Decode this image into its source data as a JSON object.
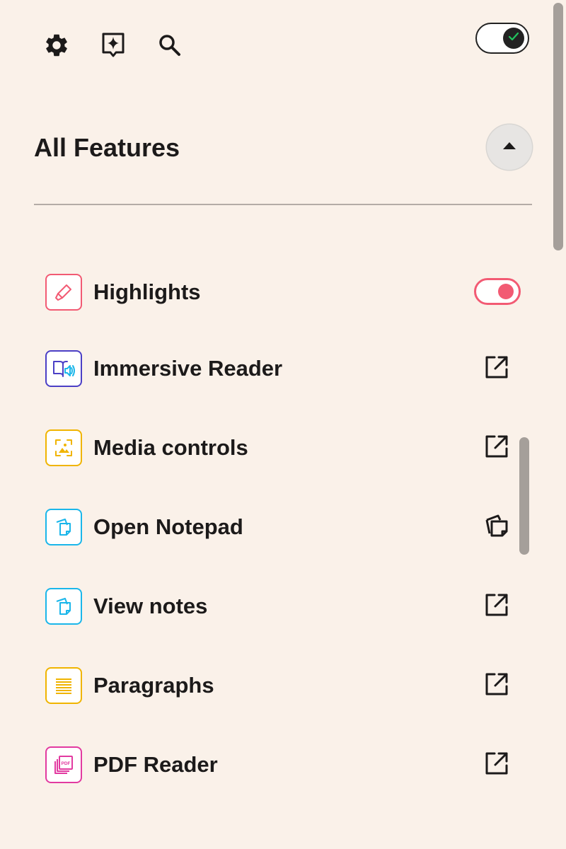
{
  "toolbar": {
    "settings_icon": "gear-icon",
    "assistant_icon": "sparkle-badge-icon",
    "search_icon": "search-icon",
    "master_toggle_on": true
  },
  "section": {
    "title": "All Features",
    "collapse_icon": "caret-up-icon"
  },
  "features": [
    {
      "label": "Highlights",
      "icon": "highlighter-icon",
      "color": "#f25a73",
      "action": "toggle",
      "toggle_on": true
    },
    {
      "label": "Immersive Reader",
      "icon": "immersive-reader-icon",
      "color": "#4b3fc6",
      "action": "open-external-icon"
    },
    {
      "label": "Media controls",
      "icon": "media-image-icon",
      "color": "#f0b400",
      "action": "open-external-icon"
    },
    {
      "label": "Open Notepad",
      "icon": "notepad-icon",
      "color": "#1ab6ea",
      "action": "copy-notes-icon"
    },
    {
      "label": "View notes",
      "icon": "notes-icon",
      "color": "#1ab6ea",
      "action": "open-external-icon"
    },
    {
      "label": "Paragraphs",
      "icon": "paragraph-lines-icon",
      "color": "#f0b400",
      "action": "open-external-icon"
    },
    {
      "label": "PDF Reader",
      "icon": "pdf-icon",
      "color": "#e23aa0",
      "action": "open-external-icon"
    }
  ],
  "colors": {
    "background": "#faf1e9",
    "text": "#1c1a1a",
    "accent_pink": "#f25a73",
    "toggle_check": "#22c55e"
  },
  "pdf_icon_text": "PDF"
}
